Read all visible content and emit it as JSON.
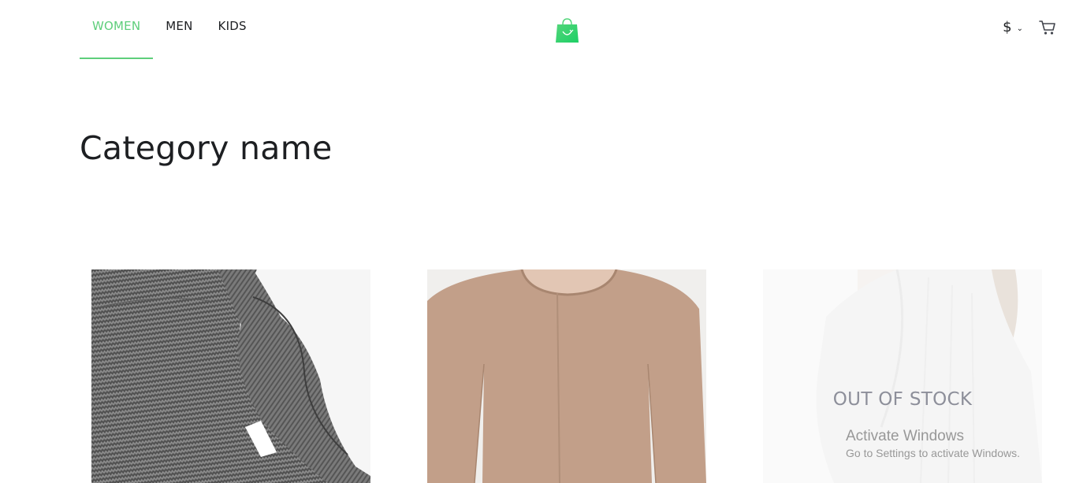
{
  "header": {
    "nav": [
      {
        "label": "WOMEN",
        "active": true
      },
      {
        "label": "MEN",
        "active": false
      },
      {
        "label": "KIDS",
        "active": false
      }
    ],
    "currency_symbol": "$",
    "accent_color": "#5ece7b",
    "icons": [
      "brand-logo-icon",
      "chevron-down-icon",
      "cart-icon"
    ]
  },
  "main": {
    "category_title": "Category name",
    "products": [
      {
        "image": "grey knit sweater",
        "in_stock": true
      },
      {
        "image": "beige sweater",
        "in_stock": true
      },
      {
        "image": "white shirt",
        "in_stock": false,
        "stock_label": "OUT OF STOCK"
      }
    ]
  },
  "os_overlay": {
    "title": "Activate Windows",
    "subtitle": "Go to Settings to activate Windows."
  }
}
